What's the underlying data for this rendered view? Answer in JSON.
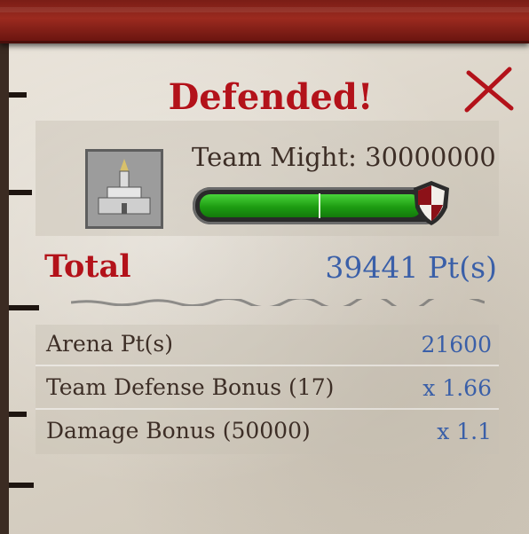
{
  "dialog": {
    "title": "Defended!"
  },
  "team": {
    "might_label": "Team Might: 30000000",
    "might_progress": 0.94,
    "castle_icon": "castle-icon",
    "shield_icon": "shield-icon"
  },
  "total": {
    "label": "Total",
    "value": "39441 Pt(s)"
  },
  "stats": [
    {
      "label": "Arena Pt(s)",
      "value": "21600"
    },
    {
      "label": "Team Defense Bonus (17)",
      "value": "x 1.66"
    },
    {
      "label": "Damage Bonus (50000)",
      "value": "x 1.1"
    }
  ],
  "colors": {
    "title": "#b3121a",
    "value_blue": "#3a5fa8",
    "progress_green": "#1d9c12"
  }
}
